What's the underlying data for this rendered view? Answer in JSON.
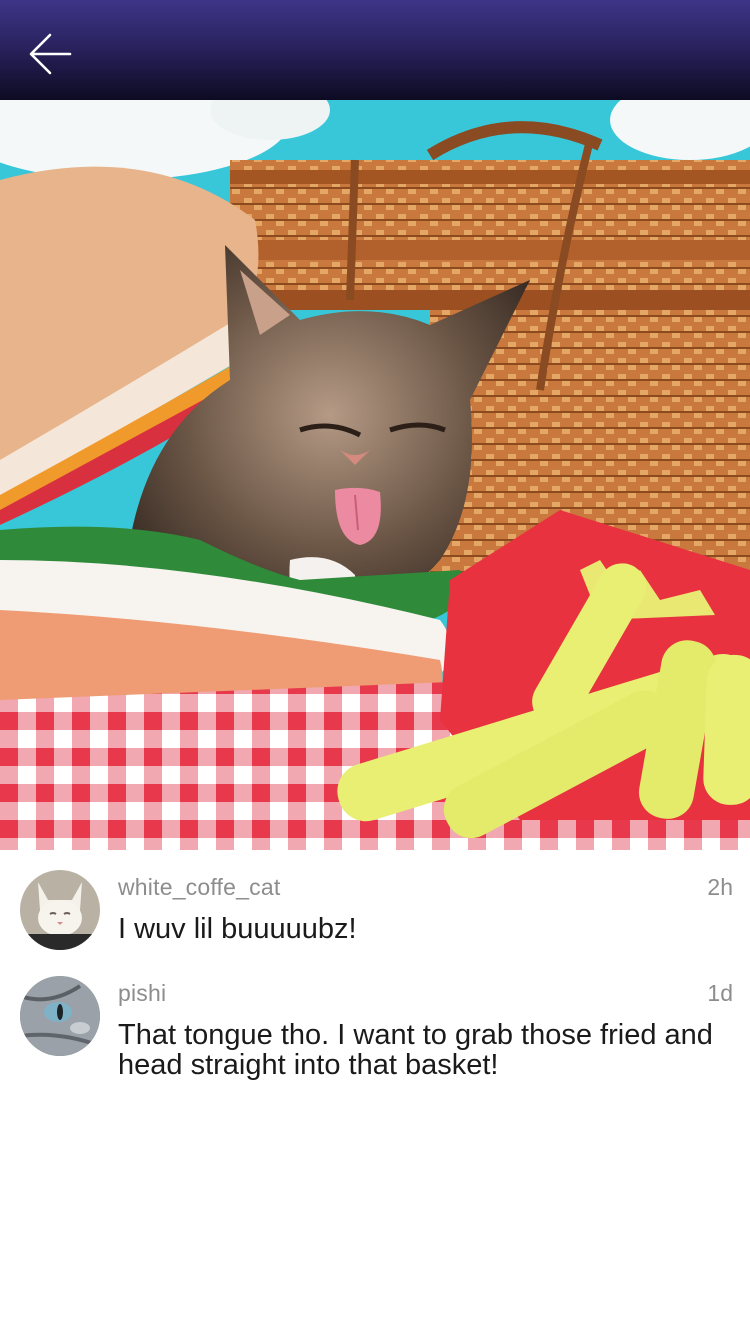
{
  "header": {
    "back_icon": "back-arrow-icon"
  },
  "post": {
    "image_icon": "cat-photo",
    "colors": {
      "sky": "#38c7d9",
      "fries_box": "#e8323f",
      "fries": "#e9ef73"
    }
  },
  "comments": [
    {
      "username": "white_coffe_cat",
      "time": "2h",
      "text": "I wuv lil buuuuubz!",
      "avatar_icon": "white-cat-avatar"
    },
    {
      "username": "pishi",
      "time": "1d",
      "text": "That tongue tho.  I want to grab those fried and head straight into that basket!",
      "avatar_icon": "grey-cat-avatar"
    }
  ]
}
